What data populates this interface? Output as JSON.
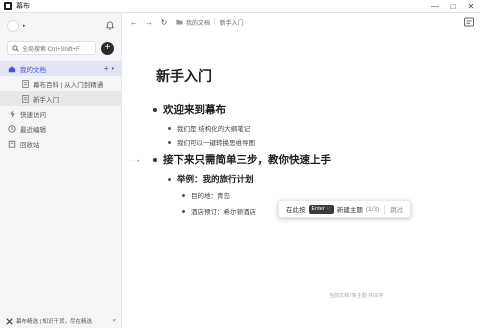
{
  "window": {
    "title": "幕布",
    "controls": [
      "—",
      "□",
      "✕"
    ]
  },
  "sidebar": {
    "search_placeholder": "全局搜索 Ctrl+Shift+F",
    "add_label": "+",
    "nav": {
      "my_docs": "我的文档",
      "children": [
        "幕布百科 | 从入门到精通",
        "新手入门"
      ],
      "quick_access": "快速访问",
      "recent_edit": "最近编辑",
      "recycle_bin": "回收站"
    },
    "footer": {
      "text": "幕布精选 | 知识干货，尽在精选"
    }
  },
  "toolbar": {
    "breadcrumb": [
      "我的文档",
      "新手入门"
    ]
  },
  "document": {
    "title": "新手入门",
    "sections": [
      {
        "heading": "欢迎来到幕布",
        "items": [
          "我们是 结构化的大纲笔记",
          "我们可以一键转换思维导图"
        ]
      },
      {
        "heading": "接下来只需简单三步，教你快速上手",
        "sub": {
          "heading": "举例：我的旅行计划",
          "items": [
            "目的地：青岛",
            "酒店预订：希尔顿酒店"
          ]
        }
      }
    ]
  },
  "tooltip": {
    "prefix": "在此按",
    "key": "Enter",
    "action": "新建主题",
    "step": "(1/3)",
    "skip": "跳过"
  },
  "status": {
    "stats": "当前文档7条主题 共56字"
  },
  "colors": {
    "accent": "#4a55c8",
    "active_bg": "#e3e3f6",
    "sidebar_bg": "#f4f5f7"
  }
}
